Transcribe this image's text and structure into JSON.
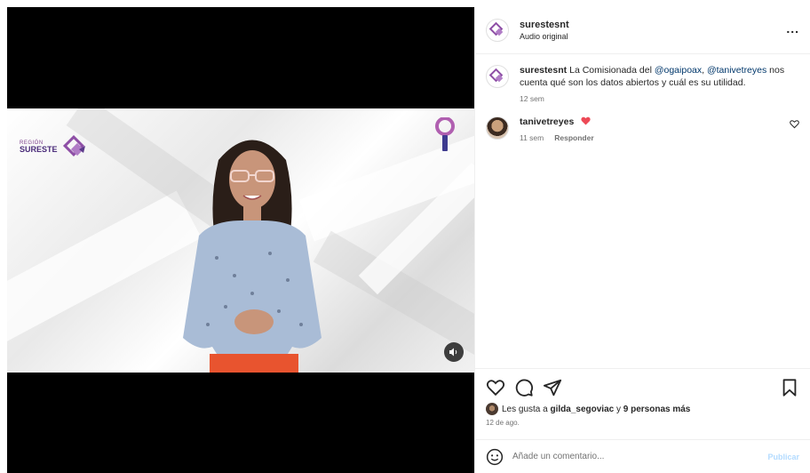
{
  "header": {
    "username": "surestesnt",
    "subtitle": "Audio original",
    "more_label": "..."
  },
  "video": {
    "brand_small": "REGIÓN",
    "brand_big": "SURESTE"
  },
  "caption": {
    "username": "surestesnt",
    "text_before": "La Comisionada del ",
    "mention_1": "@ogaipoax",
    "text_between": ", ",
    "mention_2": "@tanivetreyes",
    "text_after": " nos cuenta qué son los datos abiertos y cuál es su utilidad.",
    "time": "12 sem"
  },
  "comments": [
    {
      "username": "tanivetreyes",
      "time": "11 sem",
      "reply_label": "Responder"
    }
  ],
  "likes": {
    "prefix": "Les gusta a ",
    "user": "gilda_segoviac",
    "connector": " y ",
    "others": "9 personas más",
    "date": "12 de ago."
  },
  "add_comment": {
    "placeholder": "Añade un comentario...",
    "publish_label": "Publicar"
  },
  "colors": {
    "brand_purple": "#7b3f8c",
    "heart_red": "#ed4956",
    "link_blue": "#00376b",
    "publish_disabled": "#b3dbff"
  }
}
